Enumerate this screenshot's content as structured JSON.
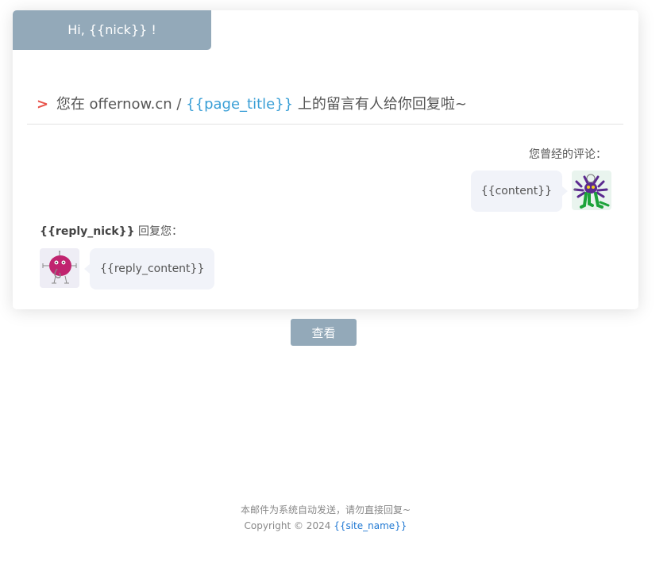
{
  "header": {
    "greeting": "Hi, {{nick}} !"
  },
  "notice": {
    "arrow": ">",
    "prefix": "您在 offernow.cn /",
    "page_title": "{{page_title}}",
    "suffix": "上的留言有人给你回复啦~"
  },
  "your_comment": {
    "label": "您曾经的评论：",
    "content": "{{content}}",
    "avatar_icon": "monster-avatar-icon"
  },
  "reply": {
    "nick": "{{reply_nick}}",
    "label": "回复您：",
    "content": "{{reply_content}}",
    "avatar_icon": "blob-avatar-icon"
  },
  "action": {
    "view_label": "查看"
  },
  "footer": {
    "note": "本邮件为系统自动发送，请勿直接回复~",
    "copyright": "Copyright © 2024",
    "site_name": "{{site_name}}"
  },
  "colors": {
    "header_bg": "#93a9b9",
    "arrow": "#e8534a",
    "accent": "#3a9fd6",
    "link": "#1e77d2",
    "bubble_bg": "#f1f3f9"
  }
}
